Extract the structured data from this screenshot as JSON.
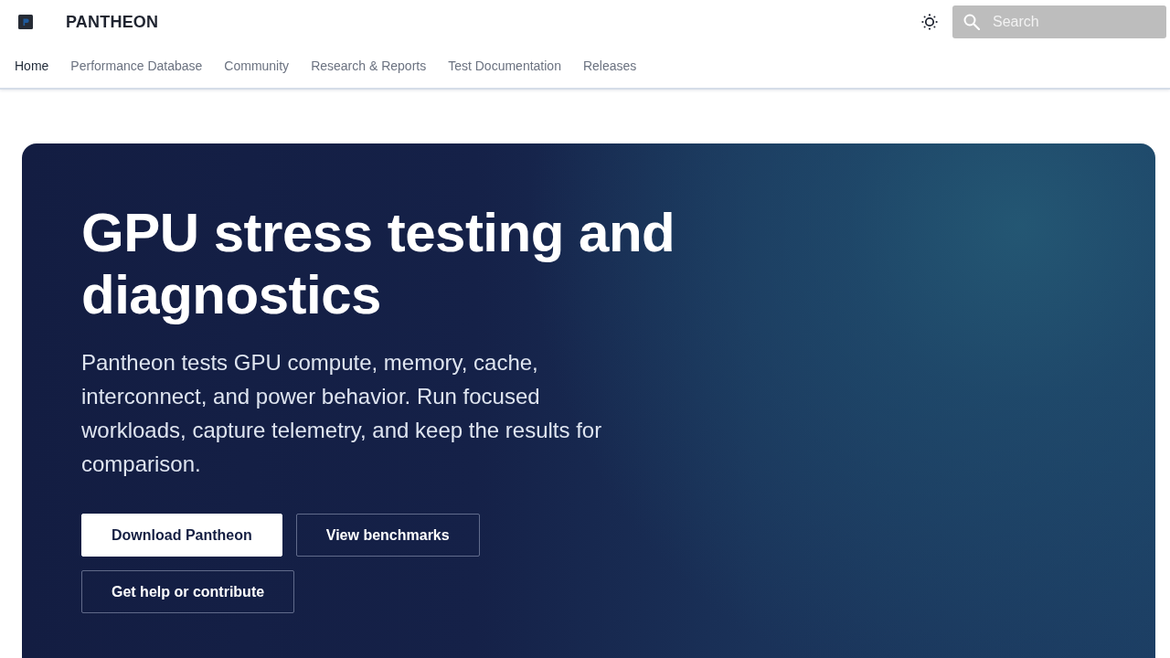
{
  "header": {
    "brand": "PANTHEON",
    "search": {
      "placeholder": "Search"
    }
  },
  "nav": [
    {
      "label": "Home",
      "selected": true
    },
    {
      "label": "Performance Database",
      "selected": false
    },
    {
      "label": "Community",
      "selected": false
    },
    {
      "label": "Research & Reports",
      "selected": false
    },
    {
      "label": "Test Documentation",
      "selected": false
    },
    {
      "label": "Releases",
      "selected": false
    }
  ],
  "hero": {
    "title": "GPU stress testing and diagnostics",
    "description": "Pantheon tests GPU compute, memory, cache, interconnect, and power behavior. Run focused workloads, capture telemetry, and keep the results for comparison.",
    "buttons": [
      {
        "label": "Download Pantheon",
        "kind": "primary"
      },
      {
        "label": "View benchmarks",
        "kind": "outline"
      },
      {
        "label": "Get help or contribute",
        "kind": "outline"
      }
    ]
  }
}
